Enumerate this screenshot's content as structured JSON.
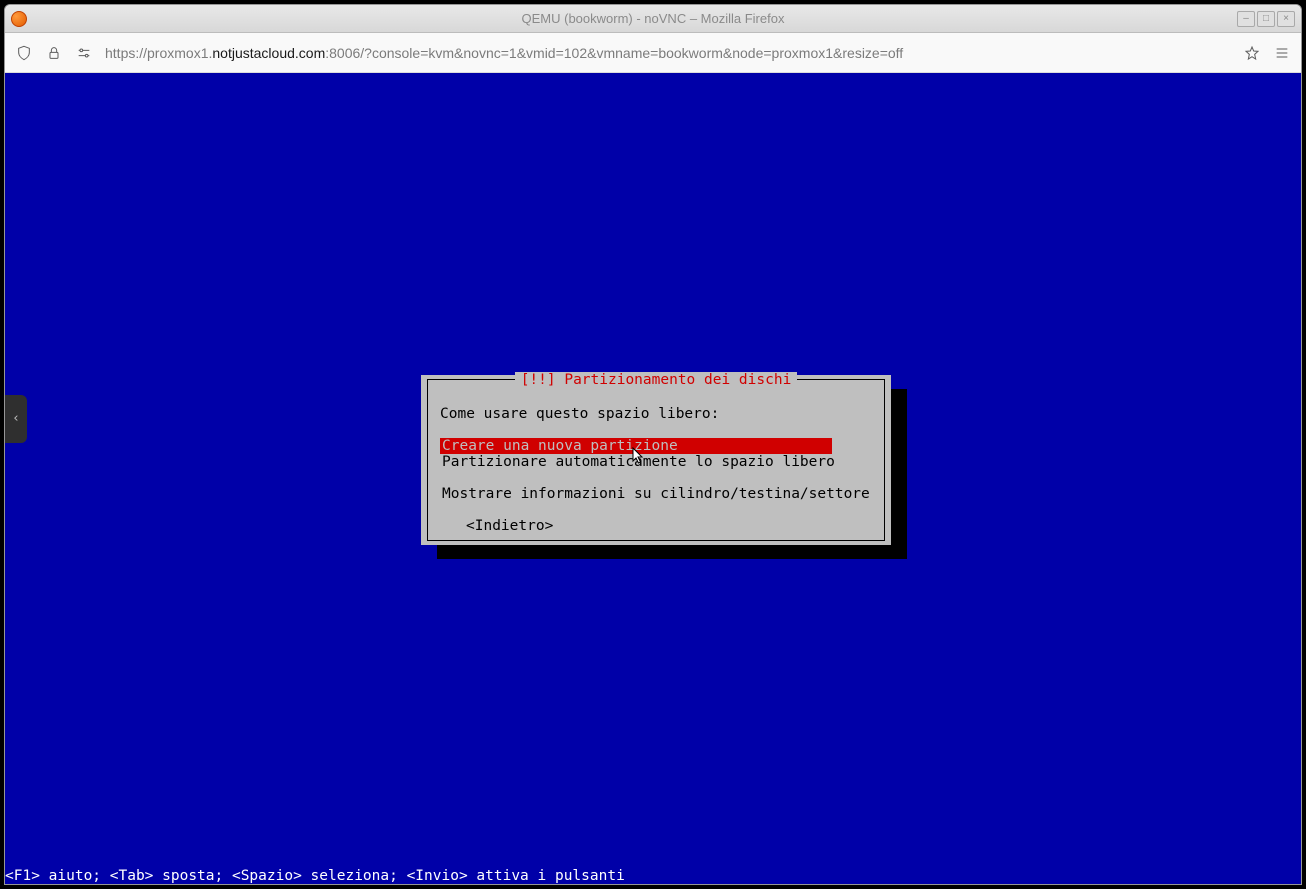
{
  "window": {
    "title": "QEMU (bookworm) - noVNC – Mozilla Firefox"
  },
  "browser": {
    "url_pre": "https://proxmox1.",
    "url_bold": "notjustacloud.com",
    "url_post": ":8006/?console=kvm&novnc=1&vmid=102&vmname=bookworm&node=proxmox1&resize=off"
  },
  "installer": {
    "dialog_title": "[!!] Partizionamento dei dischi",
    "prompt": "Come usare questo spazio libero:",
    "options": [
      "Creare una nuova partizione",
      "Partizionare automaticamente lo spazio libero",
      "Mostrare informazioni su cilindro/testina/settore"
    ],
    "selected_index": 0,
    "back_label": "<Indietro>",
    "helpbar": "<F1> aiuto; <Tab> sposta; <Spazio> seleziona; <Invio> attiva i pulsanti"
  },
  "side_handle_glyph": "‹"
}
